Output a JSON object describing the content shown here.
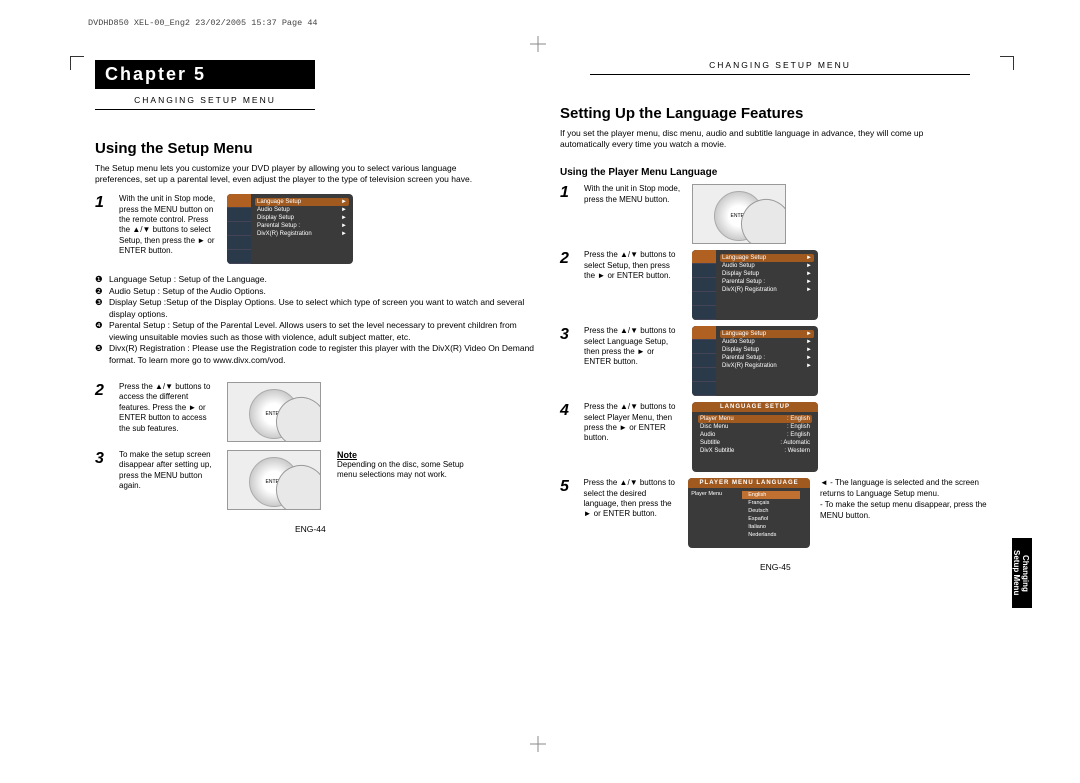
{
  "doc_header": "DVDHD850 XEL-00_Eng2   23/02/2005   15:37   Page 44",
  "chapter_label": "Chapter 5",
  "section_tag": "CHANGING SETUP MENU",
  "left": {
    "title": "Using the Setup Menu",
    "intro": "The Setup menu lets you customize your DVD player by allowing you to select various language preferences, set up a parental level, even adjust the player to the type of television screen you have.",
    "step1_num": "1",
    "step1": "With the unit in Stop mode, press the MENU button on the remote control.\nPress the ▲/▼ buttons to select Setup, then press the ► or ENTER button.",
    "setup_items": [
      {
        "n": "❶",
        "t": "Language Setup : Setup of the Language."
      },
      {
        "n": "❷",
        "t": "Audio Setup : Setup of the Audio Options."
      },
      {
        "n": "❸",
        "t": "Display Setup :Setup of the Display Options. Use to select which type of screen you want to watch and several display options."
      },
      {
        "n": "❹",
        "t": "Parental Setup : Setup of the Parental Level. Allows users to set the level necessary to prevent children from viewing unsuitable movies such as those with violence, adult subject matter, etc."
      },
      {
        "n": "❺",
        "t": "Divx(R) Registration : Please use the Registration code to register this player with the DivX(R) Video On Demand format. To learn more go to www.divx.com/vod."
      }
    ],
    "step2_num": "2",
    "step2": "Press the ▲/▼ buttons to access the different features. Press the ► or ENTER button to access the sub features.",
    "step3_num": "3",
    "step3": "To make the setup screen disappear after setting up, press the MENU button again.",
    "note_title": "Note",
    "note_body": "Depending on the disc, some Setup menu selections may not work.",
    "pagenum": "ENG-44",
    "menu": {
      "items": [
        "Language Setup",
        "Audio Setup",
        "Display Setup",
        "Parental Setup :",
        "DivX(R) Registration"
      ]
    }
  },
  "right": {
    "title": "Setting Up the Language Features",
    "intro": "If you set the player menu, disc menu, audio and subtitle language in advance, they will come up automatically every time you watch a movie.",
    "sub": "Using the Player Menu Language",
    "s1n": "1",
    "s1": "With the unit in Stop mode, press the MENU button.",
    "s2n": "2",
    "s2": "Press the ▲/▼ buttons to select Setup, then press the ► or ENTER button.",
    "s3n": "3",
    "s3": "Press the ▲/▼ buttons to select Language Setup, then press the ► or ENTER button.",
    "s4n": "4",
    "s4": "Press the ▲/▼ buttons to select Player Menu, then press the ► or ENTER button.",
    "s5n": "5",
    "s5": "Press the ▲/▼ buttons to select the desired language, then press the ► or ENTER button.",
    "notes_a": "◄ - The language is selected and the screen returns to Language Setup menu.",
    "notes_b": "   - To make the setup menu disappear, press the MENU button.",
    "pagenum": "ENG-45",
    "lang_screen": {
      "header": "LANGUAGE SETUP",
      "rows": [
        [
          "Player Menu",
          ": English"
        ],
        [
          "Disc Menu",
          ": English"
        ],
        [
          "Audio",
          ": English"
        ],
        [
          "Subtitle",
          ": Automatic"
        ],
        [
          "DivX Subtitle",
          ": Western"
        ]
      ]
    },
    "pm_screen": {
      "header": "PLAYER MENU LANGUAGE",
      "label": "Player Menu",
      "langs": [
        "English",
        "Français",
        "Deutsch",
        "Español",
        "Italiano",
        "Nederlands"
      ]
    },
    "sidetab_a": "Changing",
    "sidetab_b": "Setup Menu"
  }
}
